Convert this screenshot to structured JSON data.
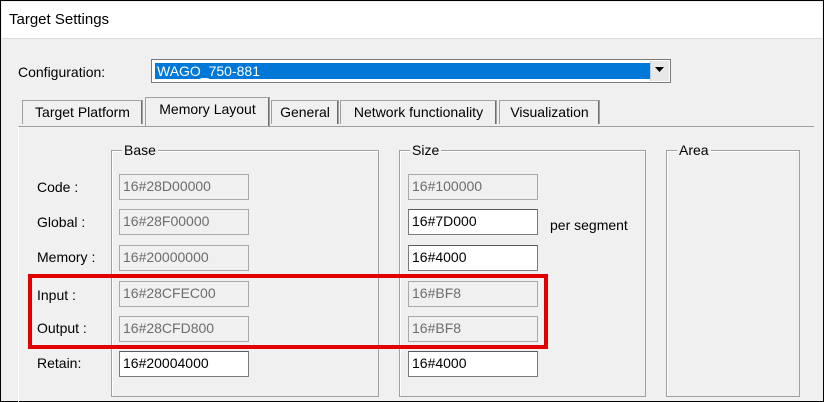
{
  "window": {
    "title": "Target Settings"
  },
  "configuration": {
    "label": "Configuration:",
    "value": "WAGO_750-881"
  },
  "tabs": [
    {
      "label": "Target Platform"
    },
    {
      "label": "Memory Layout"
    },
    {
      "label": "General"
    },
    {
      "label": "Network functionality"
    },
    {
      "label": "Visualization"
    }
  ],
  "groups": {
    "base": "Base",
    "size": "Size",
    "area": "Area"
  },
  "rows": [
    {
      "label": "Code :",
      "base": "16#28D00000",
      "size": "16#100000"
    },
    {
      "label": "Global :",
      "base": "16#28F00000",
      "size": "16#7D000"
    },
    {
      "label": "Memory :",
      "base": "16#20000000",
      "size": "16#4000"
    },
    {
      "label": "Input :",
      "base": "16#28CFEC00",
      "size": "16#BF8"
    },
    {
      "label": "Output :",
      "base": "16#28CFD800",
      "size": "16#BF8"
    },
    {
      "label": "Retain:",
      "base": "16#20004000",
      "size": "16#4000"
    }
  ],
  "per_segment_label": "per segment",
  "colors": {
    "selection": "#0078d7",
    "highlight_box": "#e00000"
  }
}
